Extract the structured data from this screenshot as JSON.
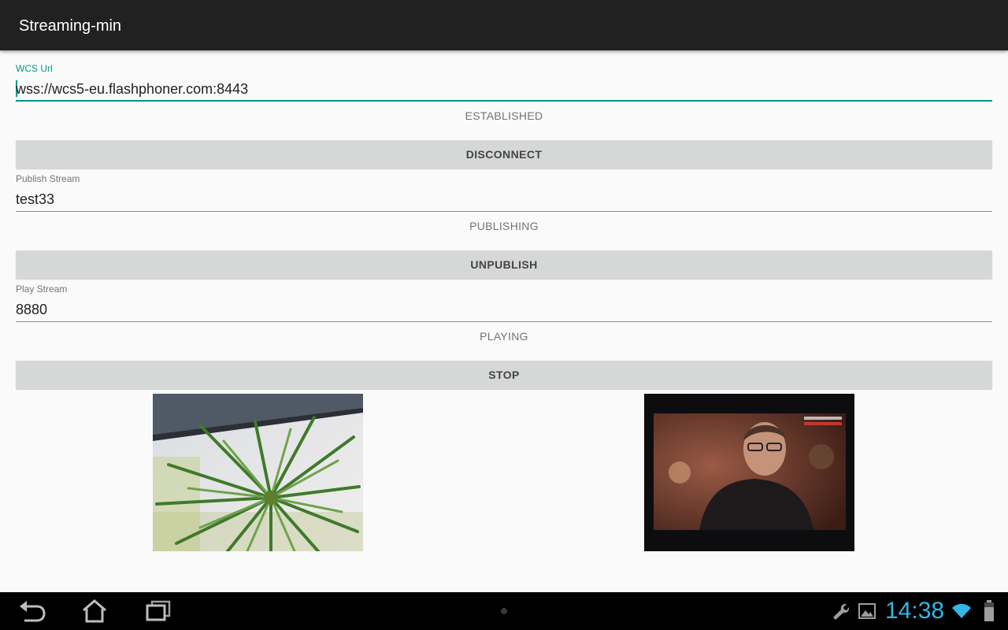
{
  "app": {
    "title": "Streaming-min"
  },
  "connection": {
    "label": "WCS Url",
    "value": "wss://wcs5-eu.flashphoner.com:8443",
    "status": "ESTABLISHED",
    "button": "DISCONNECT"
  },
  "publish": {
    "label": "Publish Stream",
    "value": "test33",
    "status": "PUBLISHING",
    "button": "UNPUBLISH"
  },
  "play": {
    "label": "Play Stream",
    "value": "8880",
    "status": "PLAYING",
    "button": "STOP"
  },
  "system": {
    "clock": "14:38",
    "accent_color": "#33b5e5",
    "focus_color": "#009688",
    "icons": [
      "back-icon",
      "home-icon",
      "recent-apps-icon",
      "wrench-icon",
      "gallery-icon",
      "wifi-icon",
      "battery-icon"
    ]
  }
}
